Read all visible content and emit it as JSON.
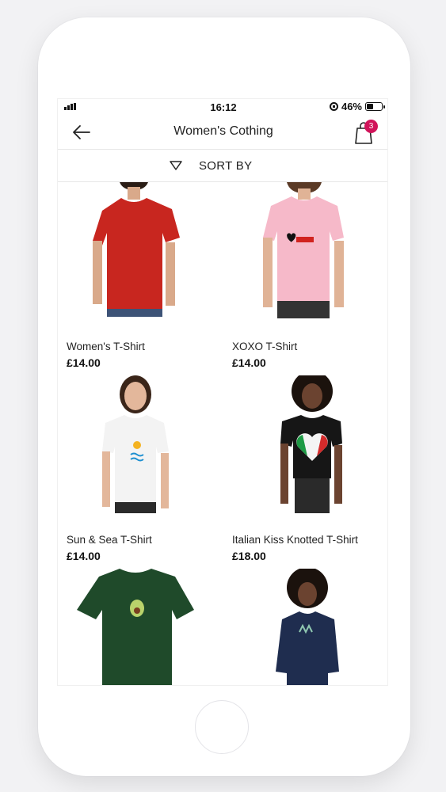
{
  "status_bar": {
    "time": "16:12",
    "battery": "46%",
    "battery_level": 0.46
  },
  "nav": {
    "title": "Women's Cothing",
    "back_icon": "arrow-left-icon",
    "cart_icon": "shopping-bag-icon",
    "cart_count": "3"
  },
  "sort": {
    "label": "SORT BY",
    "icon": "triangle-down-icon"
  },
  "products": [
    {
      "name": "Women's T-Shirt",
      "price": "£14.00",
      "shirt_color": "#c8261f"
    },
    {
      "name": "XOXO T-Shirt",
      "price": "£14.00",
      "shirt_color": "#f6b9c9"
    },
    {
      "name": "Sun & Sea T-Shirt",
      "price": "£14.00",
      "shirt_color": "#f3f3f3"
    },
    {
      "name": "Italian Kiss Knotted T-Shirt",
      "price": "£18.00",
      "shirt_color": "#161616"
    },
    {
      "name": "",
      "price": "",
      "shirt_color": "#1f4a2a"
    },
    {
      "name": "",
      "price": "",
      "shirt_color": "#1f2d4f"
    }
  ],
  "colors": {
    "accent": "#d1145a",
    "text": "#222222"
  }
}
